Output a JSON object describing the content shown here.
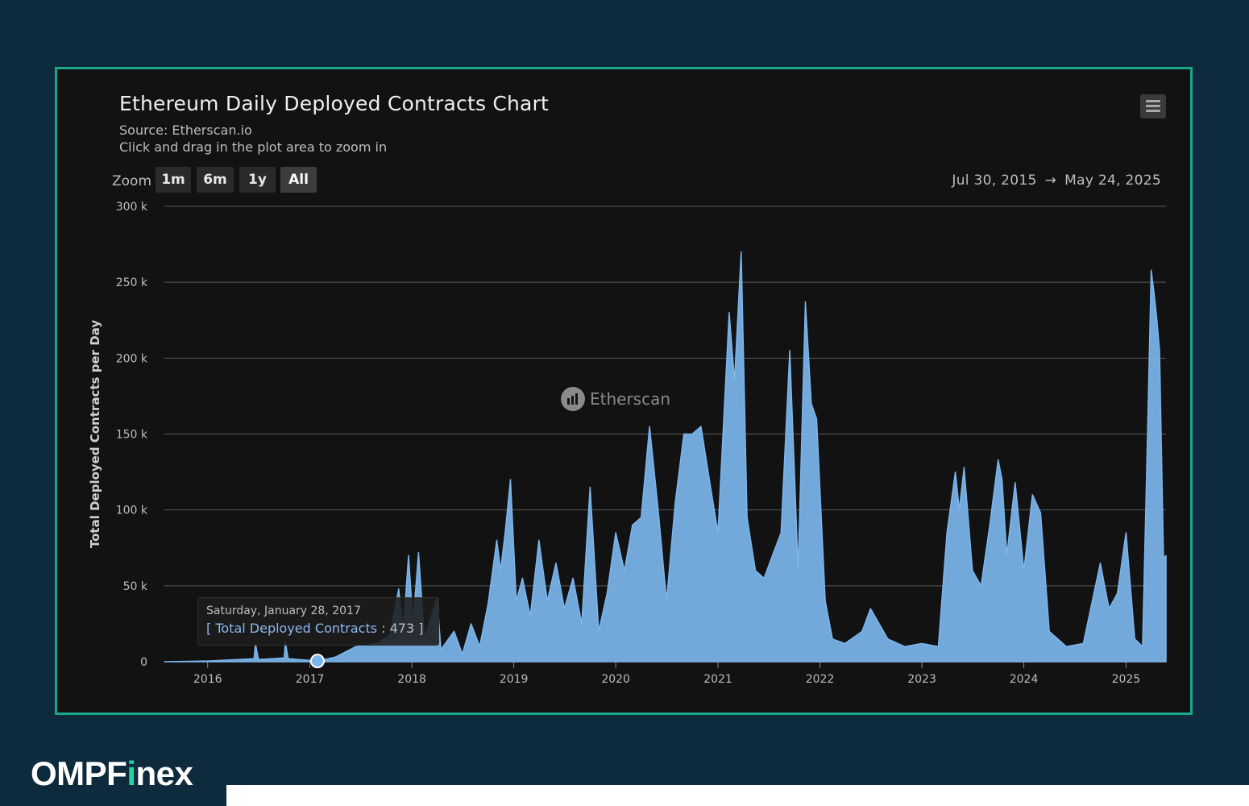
{
  "chart_title": "Ethereum Daily Deployed Contracts Chart",
  "subtitle_source": "Source: Etherscan.io",
  "subtitle_hint": "Click and drag in the plot area to zoom in",
  "zoom": {
    "label": "Zoom",
    "buttons": [
      "1m",
      "6m",
      "1y",
      "All"
    ],
    "active": "All"
  },
  "range": {
    "from": "Jul 30, 2015",
    "arrow": "→",
    "to": "May 24, 2025"
  },
  "tooltip": {
    "date": "Saturday, January 28, 2017",
    "series_label": "Total Deployed Contracts",
    "value": "473"
  },
  "watermark": "Etherscan",
  "brand": {
    "prefix": "OMPF",
    "accent_letter": "i",
    "suffix": "nex"
  },
  "colors": {
    "frame_border": "#1aa88a",
    "background": "#0e2a3d",
    "plot_background": "#121212",
    "series": "#7cb5ec",
    "brand_accent": "#1fd4a0"
  },
  "chart_data": {
    "type": "area",
    "title": "Ethereum Daily Deployed Contracts Chart",
    "ylabel": "Total Deployed Contracts per Day",
    "xlabel": "",
    "xlim": [
      "2015-07-30",
      "2025-05-24"
    ],
    "ylim": [
      0,
      300000
    ],
    "y_ticks": [
      0,
      50000,
      100000,
      150000,
      200000,
      250000,
      300000
    ],
    "y_tick_labels": [
      "0",
      "50 k",
      "100 k",
      "150 k",
      "200 k",
      "250 k",
      "300 k"
    ],
    "x_ticks": [
      "2016",
      "2017",
      "2018",
      "2019",
      "2020",
      "2021",
      "2022",
      "2023",
      "2024",
      "2025"
    ],
    "grid": true,
    "legend": "none",
    "highlight_point": {
      "x": "2017-01-28",
      "y": 473
    },
    "series": [
      {
        "name": "Total Deployed Contracts",
        "points": [
          [
            "2015-07-30",
            0
          ],
          [
            "2016-01-01",
            500
          ],
          [
            "2016-06-15",
            2000
          ],
          [
            "2016-06-20",
            12000
          ],
          [
            "2016-07-01",
            1500
          ],
          [
            "2016-10-01",
            2500
          ],
          [
            "2016-10-05",
            13000
          ],
          [
            "2016-10-15",
            2000
          ],
          [
            "2017-01-28",
            473
          ],
          [
            "2017-04-01",
            3000
          ],
          [
            "2017-06-15",
            10000
          ],
          [
            "2017-09-01",
            12000
          ],
          [
            "2017-10-15",
            18000
          ],
          [
            "2017-11-15",
            48000
          ],
          [
            "2017-12-01",
            20000
          ],
          [
            "2017-12-20",
            70000
          ],
          [
            "2018-01-05",
            25000
          ],
          [
            "2018-01-25",
            72000
          ],
          [
            "2018-02-15",
            15000
          ],
          [
            "2018-04-01",
            42000
          ],
          [
            "2018-04-15",
            8000
          ],
          [
            "2018-06-01",
            20000
          ],
          [
            "2018-07-01",
            5000
          ],
          [
            "2018-08-01",
            25000
          ],
          [
            "2018-09-01",
            10000
          ],
          [
            "2018-10-01",
            38000
          ],
          [
            "2018-11-01",
            80000
          ],
          [
            "2018-11-15",
            60000
          ],
          [
            "2018-12-01",
            85000
          ],
          [
            "2018-12-20",
            120000
          ],
          [
            "2019-01-10",
            40000
          ],
          [
            "2019-02-01",
            55000
          ],
          [
            "2019-03-01",
            30000
          ],
          [
            "2019-04-01",
            80000
          ],
          [
            "2019-05-01",
            40000
          ],
          [
            "2019-06-01",
            65000
          ],
          [
            "2019-07-01",
            35000
          ],
          [
            "2019-08-01",
            55000
          ],
          [
            "2019-09-01",
            25000
          ],
          [
            "2019-10-01",
            115000
          ],
          [
            "2019-11-01",
            20000
          ],
          [
            "2019-12-01",
            45000
          ],
          [
            "2020-01-01",
            85000
          ],
          [
            "2020-02-01",
            60000
          ],
          [
            "2020-03-01",
            90000
          ],
          [
            "2020-04-01",
            95000
          ],
          [
            "2020-05-01",
            155000
          ],
          [
            "2020-06-01",
            100000
          ],
          [
            "2020-07-01",
            40000
          ],
          [
            "2020-08-01",
            105000
          ],
          [
            "2020-09-01",
            150000
          ],
          [
            "2020-10-01",
            150000
          ],
          [
            "2020-11-01",
            155000
          ],
          [
            "2020-12-01",
            120000
          ],
          [
            "2021-01-01",
            85000
          ],
          [
            "2021-02-10",
            230000
          ],
          [
            "2021-03-01",
            185000
          ],
          [
            "2021-03-25",
            270000
          ],
          [
            "2021-04-15",
            95000
          ],
          [
            "2021-05-15",
            60000
          ],
          [
            "2021-06-15",
            55000
          ],
          [
            "2021-07-15",
            70000
          ],
          [
            "2021-08-15",
            85000
          ],
          [
            "2021-09-15",
            205000
          ],
          [
            "2021-10-15",
            60000
          ],
          [
            "2021-11-10",
            237000
          ],
          [
            "2021-12-01",
            170000
          ],
          [
            "2021-12-20",
            160000
          ],
          [
            "2022-01-20",
            40000
          ],
          [
            "2022-02-15",
            15000
          ],
          [
            "2022-04-01",
            12000
          ],
          [
            "2022-06-01",
            20000
          ],
          [
            "2022-07-01",
            35000
          ],
          [
            "2022-09-01",
            15000
          ],
          [
            "2022-11-01",
            10000
          ],
          [
            "2023-01-01",
            12000
          ],
          [
            "2023-03-01",
            10000
          ],
          [
            "2023-04-01",
            85000
          ],
          [
            "2023-05-01",
            125000
          ],
          [
            "2023-05-15",
            100000
          ],
          [
            "2023-06-01",
            128000
          ],
          [
            "2023-07-01",
            60000
          ],
          [
            "2023-08-01",
            50000
          ],
          [
            "2023-09-01",
            90000
          ],
          [
            "2023-10-01",
            133000
          ],
          [
            "2023-10-15",
            120000
          ],
          [
            "2023-11-01",
            70000
          ],
          [
            "2023-12-01",
            118000
          ],
          [
            "2024-01-01",
            60000
          ],
          [
            "2024-02-01",
            110000
          ],
          [
            "2024-03-01",
            98000
          ],
          [
            "2024-04-01",
            20000
          ],
          [
            "2024-06-01",
            10000
          ],
          [
            "2024-08-01",
            12000
          ],
          [
            "2024-10-01",
            65000
          ],
          [
            "2024-11-01",
            35000
          ],
          [
            "2024-12-01",
            45000
          ],
          [
            "2025-01-01",
            85000
          ],
          [
            "2025-02-01",
            15000
          ],
          [
            "2025-03-01",
            10000
          ],
          [
            "2025-03-20",
            160000
          ],
          [
            "2025-04-01",
            258000
          ],
          [
            "2025-04-10",
            245000
          ],
          [
            "2025-04-20",
            228000
          ],
          [
            "2025-05-01",
            205000
          ],
          [
            "2025-05-15",
            68000
          ],
          [
            "2025-05-24",
            70000
          ]
        ]
      }
    ]
  }
}
